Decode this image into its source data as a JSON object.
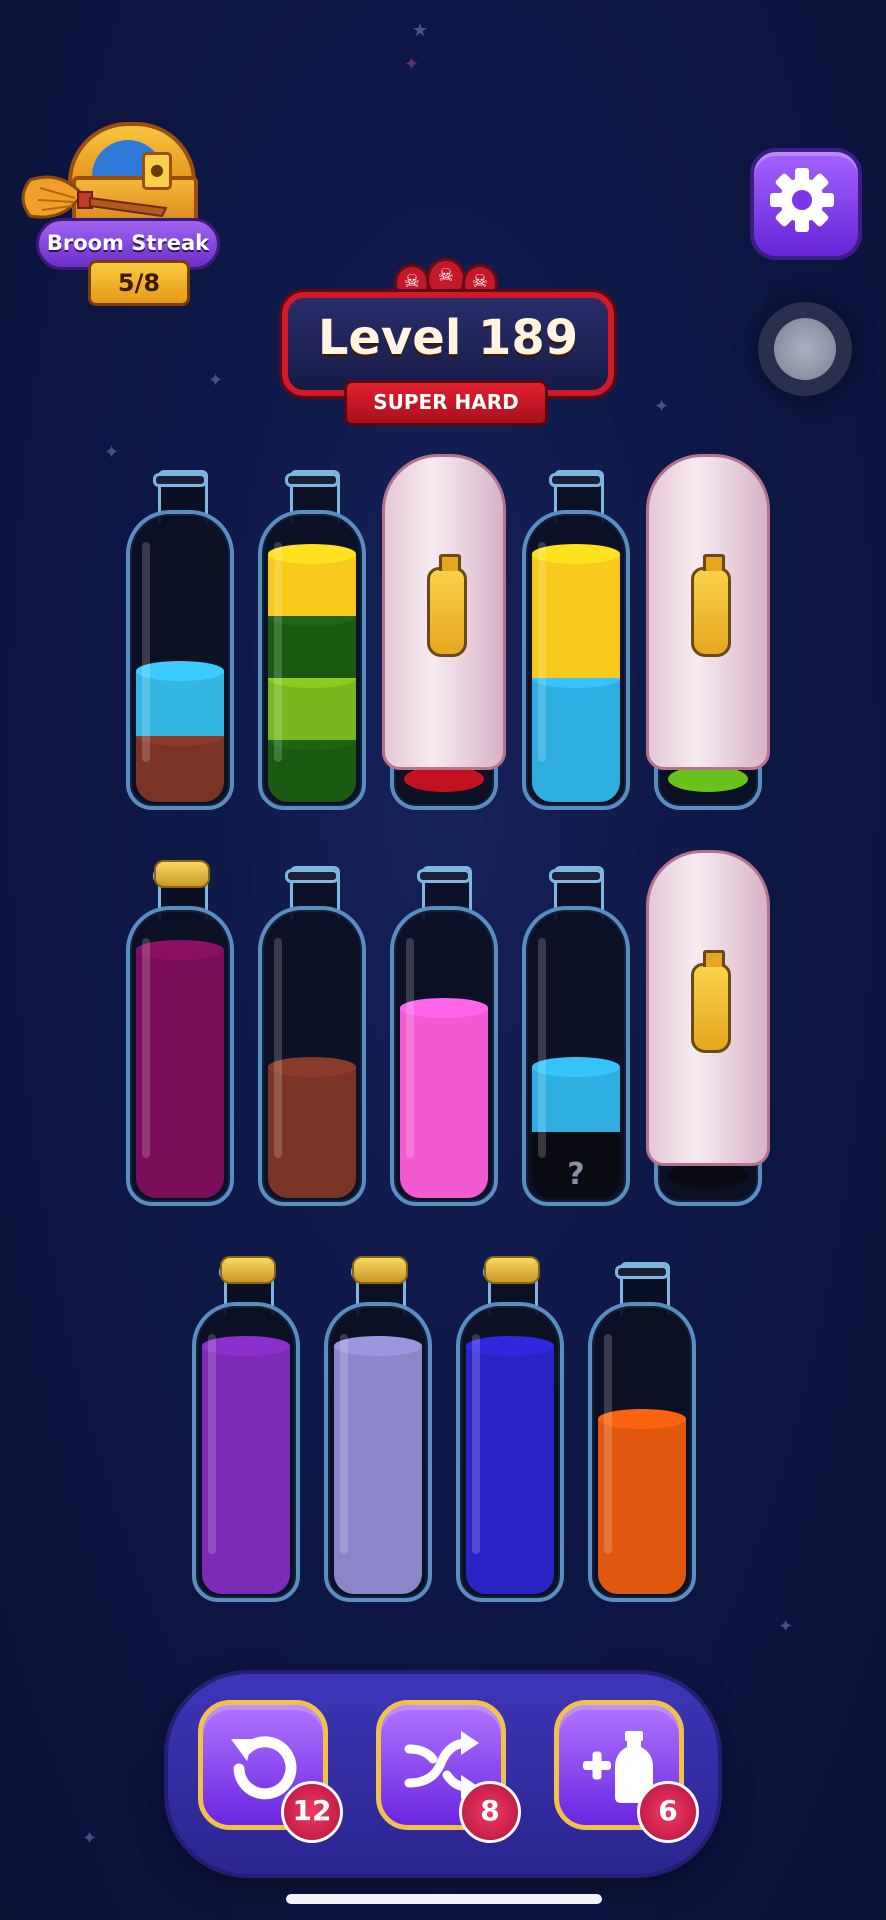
{
  "streak": {
    "label": "Broom Streak",
    "count": "5/8"
  },
  "level": {
    "title": "Level 189",
    "difficulty": "SUPER HARD",
    "skull_count": 3
  },
  "icons": {
    "settings": "gear-icon",
    "undo": "undo-icon",
    "shuffle": "shuffle-icon",
    "add_bottle": "add-bottle-icon",
    "record": "record-icon"
  },
  "bottles": [
    {
      "id": 1,
      "row": 1,
      "layers_bottom_to_top": [
        "#7a3426",
        "#35b6e2"
      ],
      "fill": 0.45
    },
    {
      "id": 2,
      "row": 1,
      "layers_bottom_to_top": [
        "#1c5a14",
        "#7ab61e",
        "#1c5a14",
        "#f6c91a"
      ],
      "fill": 0.85
    },
    {
      "id": 3,
      "row": 1,
      "hidden": true,
      "visible_base": "#c21220"
    },
    {
      "id": 4,
      "row": 1,
      "layers_bottom_to_top": [
        "#2eaee0",
        "#f6c91a"
      ],
      "fill": 0.85
    },
    {
      "id": 5,
      "row": 1,
      "hidden": true,
      "visible_base": "#6ac21a"
    },
    {
      "id": 6,
      "row": 2,
      "corked": true,
      "layers_bottom_to_top": [
        "#7a0e5a"
      ],
      "fill": 0.85
    },
    {
      "id": 7,
      "row": 2,
      "layers_bottom_to_top": [
        "#7a3426"
      ],
      "fill": 0.45
    },
    {
      "id": 8,
      "row": 2,
      "layers_bottom_to_top": [
        "#f25ad2"
      ],
      "fill": 0.65
    },
    {
      "id": 9,
      "row": 2,
      "unknown_bottom": "?",
      "layers_bottom_to_top": [
        "#0a0a12",
        "#2eaee0"
      ],
      "fill": 0.45
    },
    {
      "id": 10,
      "row": 2,
      "hidden": true,
      "visible_base": "#0a0a12"
    },
    {
      "id": 11,
      "row": 3,
      "corked": true,
      "layers_bottom_to_top": [
        "#7c2ab8"
      ],
      "fill": 0.85
    },
    {
      "id": 12,
      "row": 3,
      "corked": true,
      "layers_bottom_to_top": [
        "#8a86c8"
      ],
      "fill": 0.85
    },
    {
      "id": 13,
      "row": 3,
      "corked": true,
      "layers_bottom_to_top": [
        "#2a24c6"
      ],
      "fill": 0.85
    },
    {
      "id": 14,
      "row": 3,
      "layers_bottom_to_top": [
        "#e0580e"
      ],
      "fill": 0.6
    }
  ],
  "toolbar": {
    "undo_count": "12",
    "shuffle_count": "8",
    "add_bottle_count": "6"
  },
  "colors": {
    "background": "#0e1846",
    "accent": "#7a3cf0",
    "badge": "#d81e50",
    "frame": "#f1c24a"
  }
}
